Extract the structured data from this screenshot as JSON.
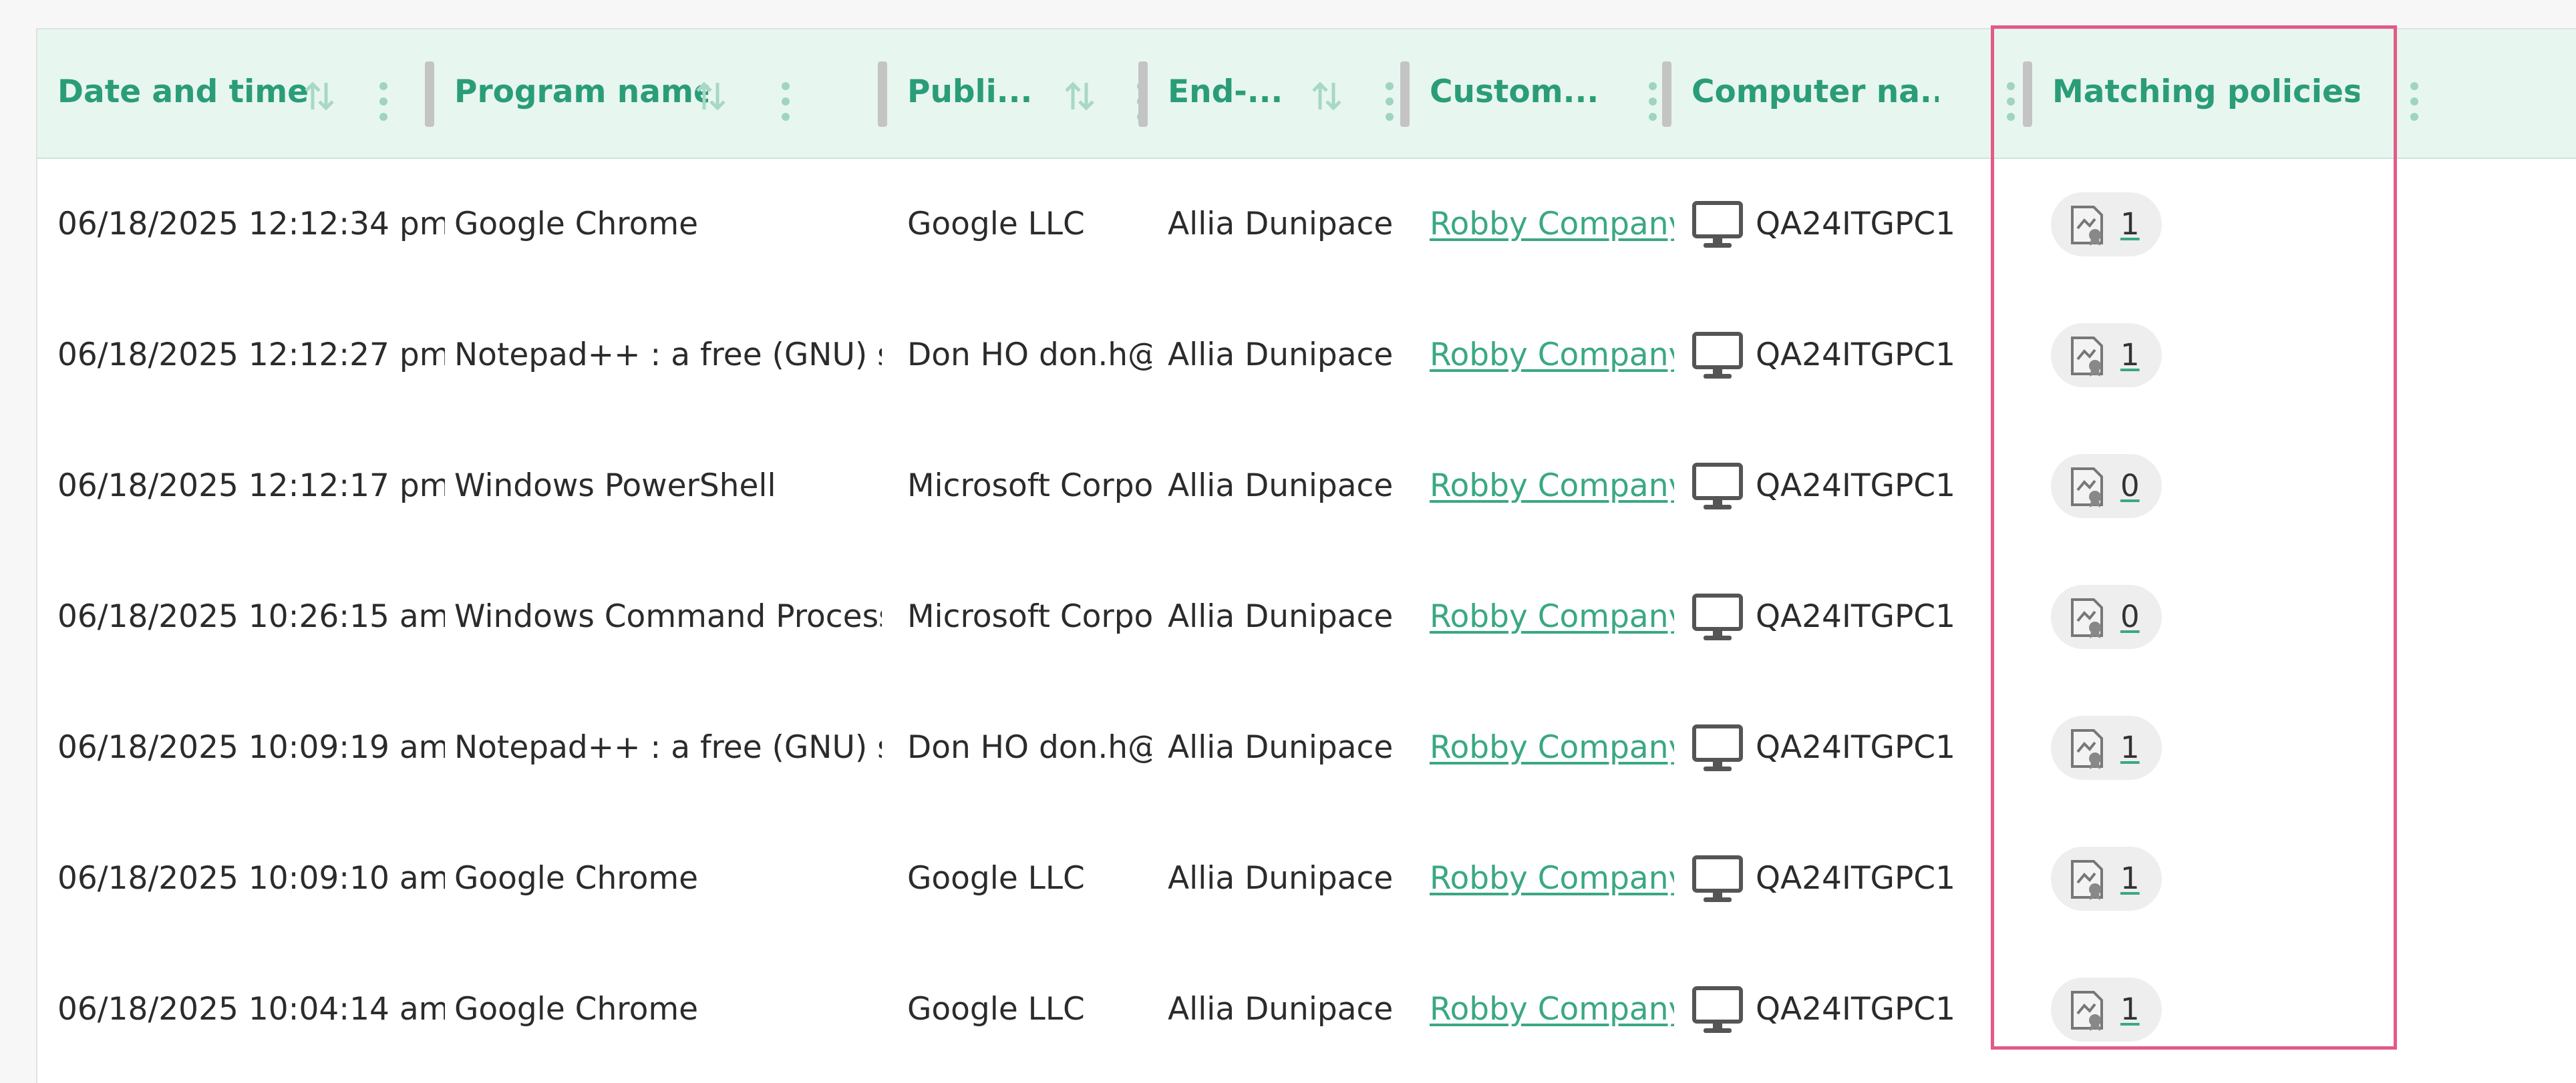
{
  "columns": [
    {
      "label": "Date and time",
      "sortable": true
    },
    {
      "label": "Program name",
      "sortable": true
    },
    {
      "label": "Publi...",
      "sortable": true
    },
    {
      "label": "End-...",
      "sortable": true
    },
    {
      "label": "Custom...",
      "sortable": false
    },
    {
      "label": "Computer na...",
      "sortable": false
    },
    {
      "label": "Matching policies",
      "sortable": false
    }
  ],
  "rows": [
    {
      "datetime": "06/18/2025 12:12:34 pm",
      "program": "Google Chrome",
      "publisher": "Google LLC",
      "end_user": "Allia Dunipace",
      "customer": "Robby Company",
      "computer": "QA24ITGPC1",
      "policies": "1"
    },
    {
      "datetime": "06/18/2025 12:12:27 pm",
      "program": "Notepad++ : a free (GNU) so",
      "publisher": "Don HO don.h@",
      "end_user": "Allia Dunipace",
      "customer": "Robby Company",
      "computer": "QA24ITGPC1",
      "policies": "1"
    },
    {
      "datetime": "06/18/2025 12:12:17 pm",
      "program": "Windows PowerShell",
      "publisher": "Microsoft Corpo",
      "end_user": "Allia Dunipace",
      "customer": "Robby Company",
      "computer": "QA24ITGPC1",
      "policies": "0"
    },
    {
      "datetime": "06/18/2025 10:26:15 am",
      "program": "Windows Command Process",
      "publisher": "Microsoft Corpo",
      "end_user": "Allia Dunipace",
      "customer": "Robby Company",
      "computer": "QA24ITGPC1",
      "policies": "0"
    },
    {
      "datetime": "06/18/2025 10:09:19 am",
      "program": "Notepad++ : a free (GNU) so",
      "publisher": "Don HO don.h@",
      "end_user": "Allia Dunipace",
      "customer": "Robby Company",
      "computer": "QA24ITGPC1",
      "policies": "1"
    },
    {
      "datetime": "06/18/2025 10:09:10 am",
      "program": "Google Chrome",
      "publisher": "Google LLC",
      "end_user": "Allia Dunipace",
      "customer": "Robby Company",
      "computer": "QA24ITGPC1",
      "policies": "1"
    },
    {
      "datetime": "06/18/2025 10:04:14 am",
      "program": "Google Chrome",
      "publisher": "Google LLC",
      "end_user": "Allia Dunipace",
      "customer": "Robby Company",
      "computer": "QA24ITGPC1",
      "policies": "1"
    }
  ],
  "icons": {
    "sort": "sort-arrows-icon",
    "menu": "kebab-menu-icon",
    "computer": "computer-monitor-icon",
    "policy": "certificate-icon"
  },
  "colors": {
    "accent": "#2a9d78",
    "link": "#3aa882",
    "header_bg": "#e8f6f0",
    "highlight": "#e25b8a"
  }
}
